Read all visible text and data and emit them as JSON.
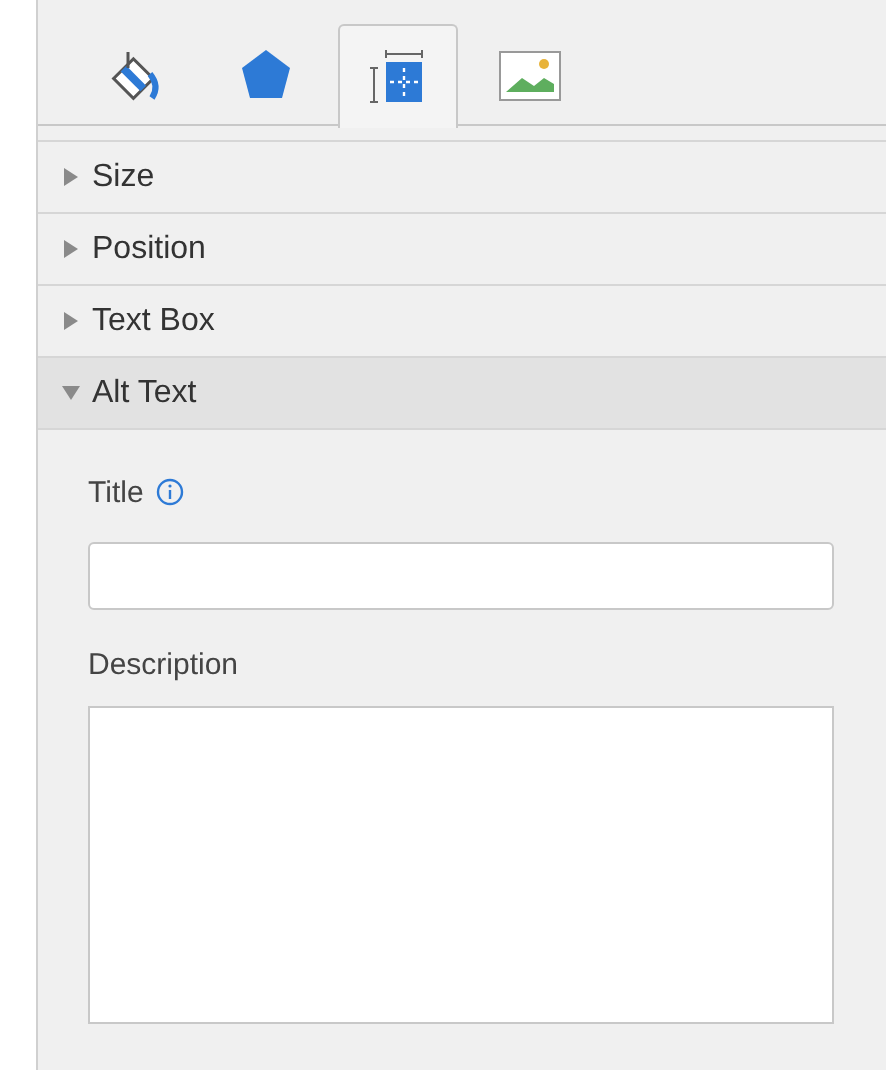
{
  "tabs": [
    {
      "kind": "fill",
      "selected": false
    },
    {
      "kind": "shape",
      "selected": false
    },
    {
      "kind": "layout",
      "selected": true
    },
    {
      "kind": "picture",
      "selected": false
    }
  ],
  "sections": [
    {
      "label": "Size",
      "expanded": false
    },
    {
      "label": "Position",
      "expanded": false
    },
    {
      "label": "Text Box",
      "expanded": false
    },
    {
      "label": "Alt Text",
      "expanded": true
    }
  ],
  "alt_text": {
    "title_label": "Title",
    "description_label": "Description"
  }
}
